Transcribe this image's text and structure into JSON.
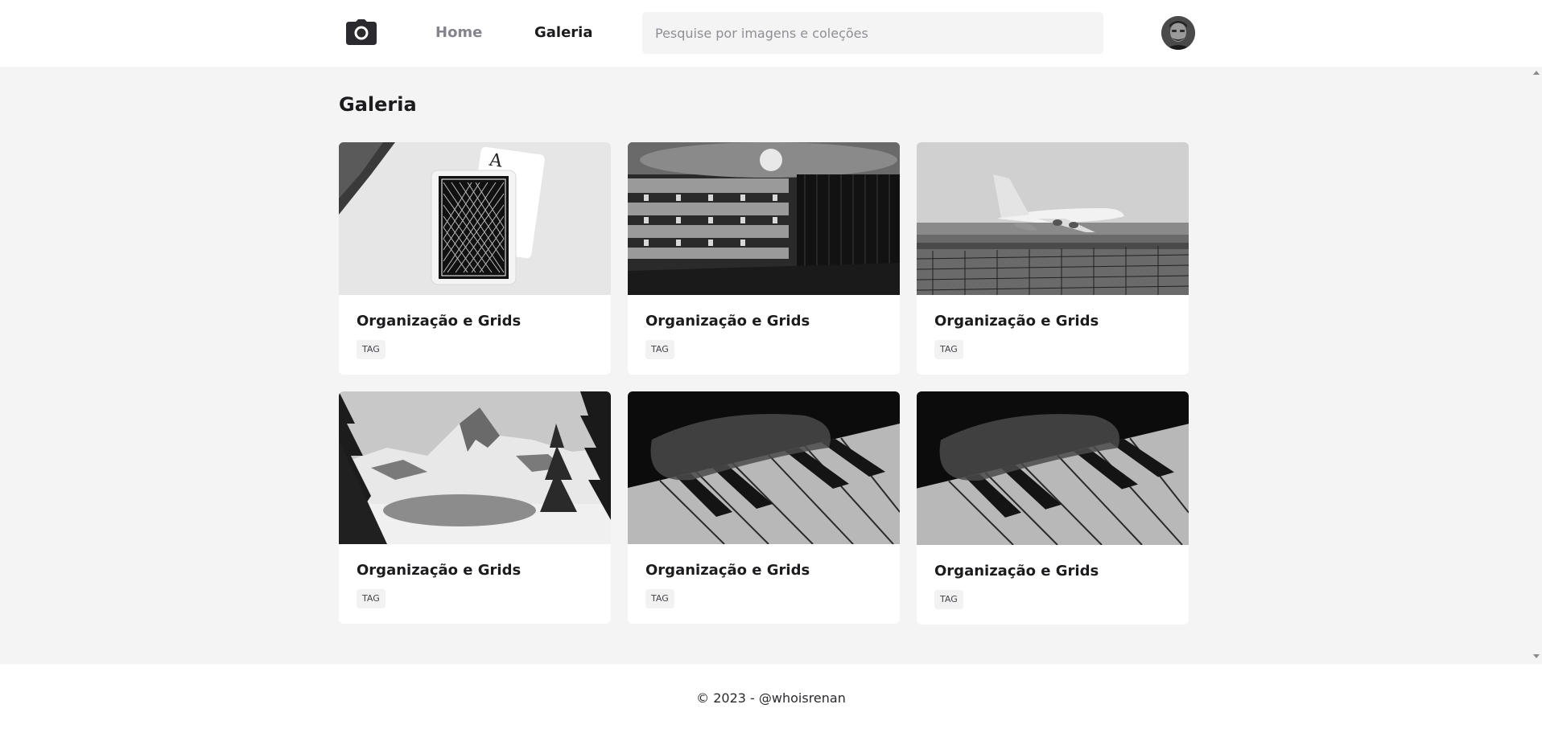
{
  "header": {
    "logo_icon": "camera-icon",
    "nav": [
      {
        "label": "Home",
        "active": false
      },
      {
        "label": "Galeria",
        "active": true
      }
    ],
    "search": {
      "placeholder": "Pesquise por imagens e coleções",
      "value": ""
    },
    "avatar_icon": "user-avatar"
  },
  "main": {
    "title": "Galeria",
    "cards": [
      {
        "title": "Organização e Grids",
        "tag": "TAG",
        "image": "playing-cards-photo"
      },
      {
        "title": "Organização e Grids",
        "tag": "TAG",
        "image": "theater-photo"
      },
      {
        "title": "Organização e Grids",
        "tag": "TAG",
        "image": "airplane-photo"
      },
      {
        "title": "Organização e Grids",
        "tag": "TAG",
        "image": "mountain-lake-photo"
      },
      {
        "title": "Organização e Grids",
        "tag": "TAG",
        "image": "piano-keys-photo"
      },
      {
        "title": "Organização e Grids",
        "tag": "TAG",
        "image": "piano-keys-photo"
      }
    ]
  },
  "footer": {
    "text": "© 2023 - @whoisrenan"
  },
  "colors": {
    "background": "#f4f4f4",
    "surface": "#ffffff",
    "text": "#1c1c1f",
    "muted": "#85848c"
  }
}
